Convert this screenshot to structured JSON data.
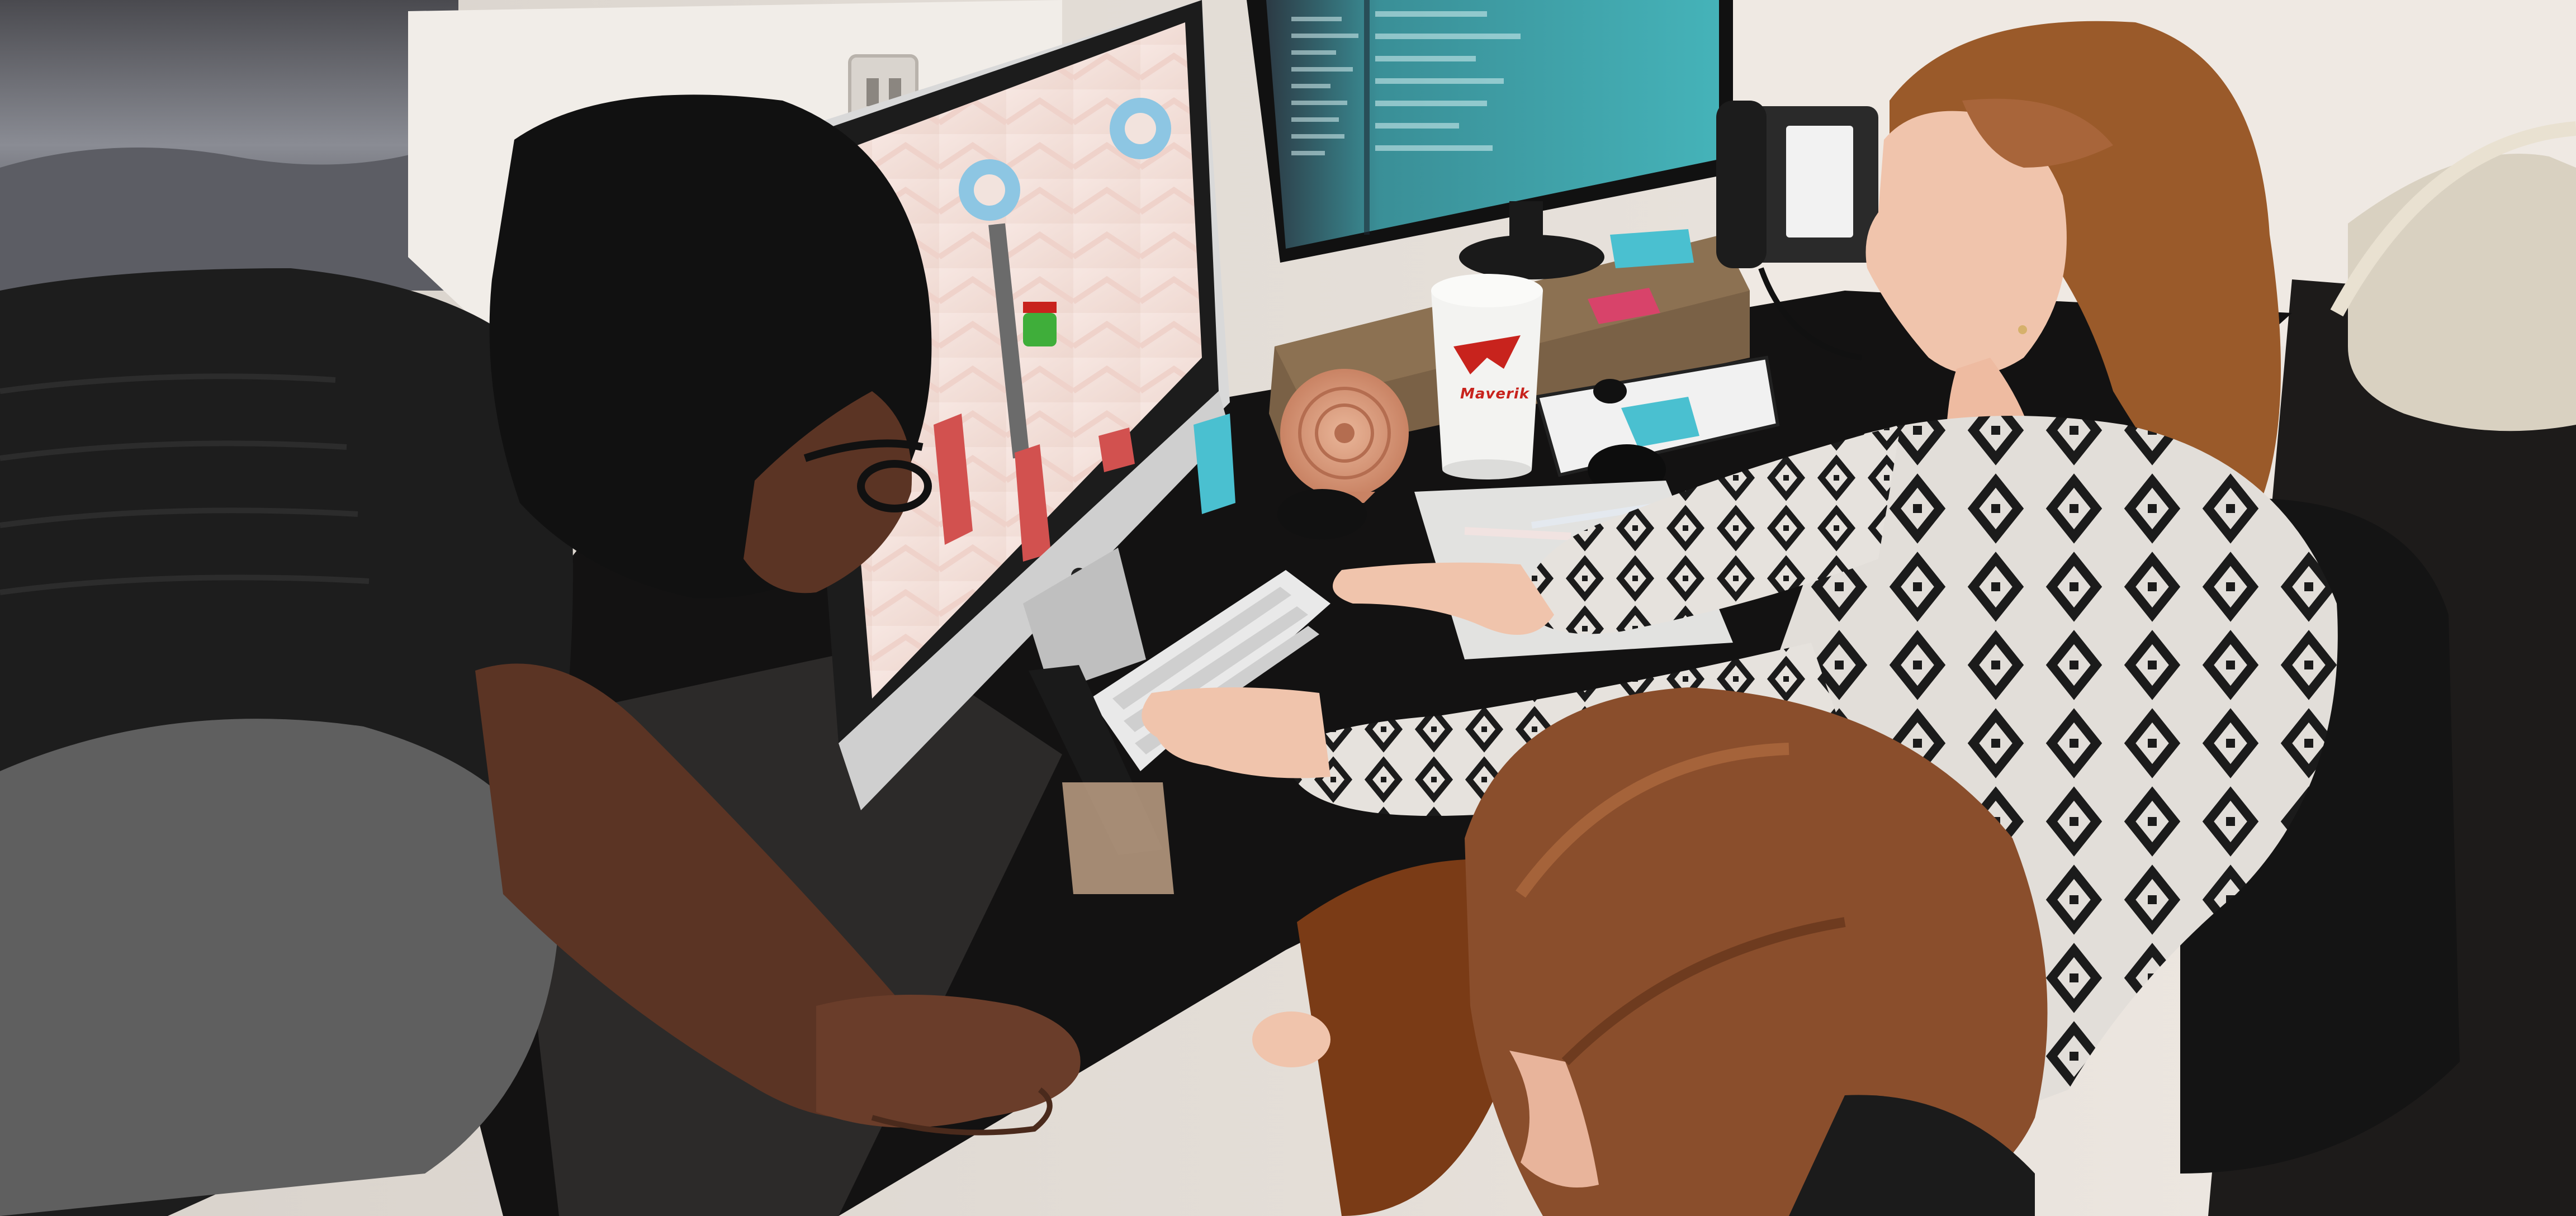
{
  "scene": {
    "description_tags": [
      "office",
      "desk",
      "monitors",
      "game-on-screen"
    ],
    "cup": {
      "brand_text": "Maverik",
      "brand_color": "#c8231d"
    },
    "palette": {
      "wall": "#ece6df",
      "desk": "#141313",
      "game_background": "#f2ded8",
      "code_editor": "#3aa2a8",
      "sweater_light": "#e3e0dc",
      "sweater_dark": "#1b1b1b",
      "hair_woman": "#9a5a2a",
      "hair_child": "#8a4e2c",
      "fan": "#d9987a"
    }
  }
}
